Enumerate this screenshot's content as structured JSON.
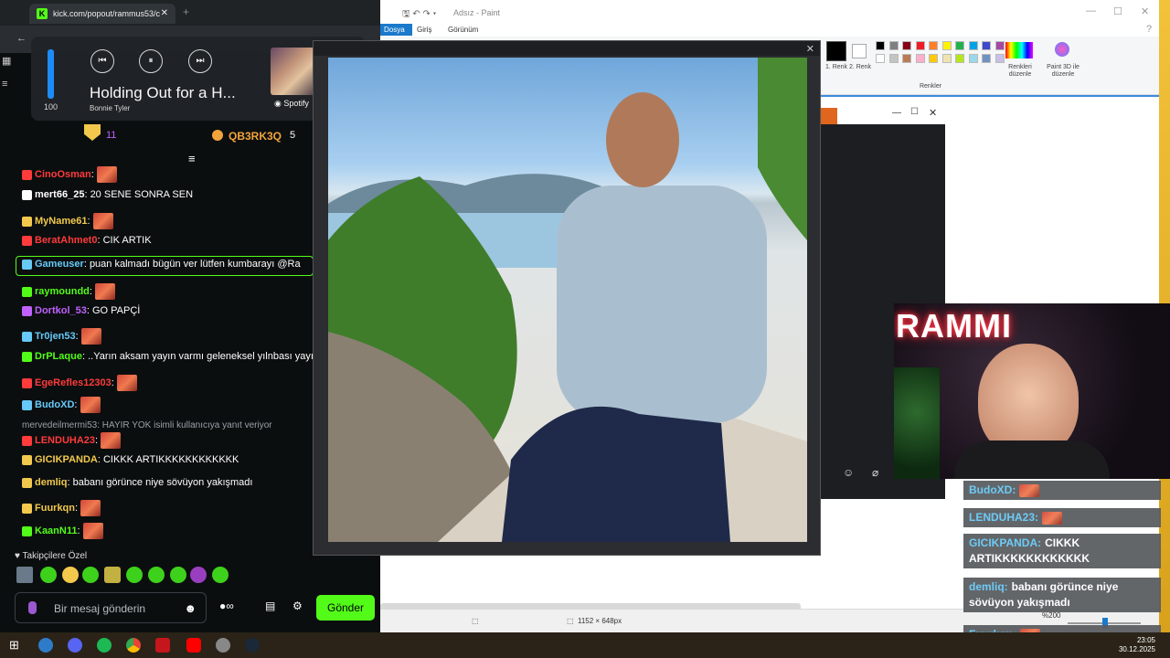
{
  "browser": {
    "tab_title": "kick.com/popout/rammus53/c",
    "tab_close": "✕",
    "new_tab": "+"
  },
  "media": {
    "volume": 100,
    "volume_label": "100",
    "song_title": "Holding Out for a H...",
    "artist": "Bonnie Tyler",
    "source": "Spotify",
    "prev_icon": "⏮",
    "pause_icon": "⏸",
    "next_icon": "⏭",
    "more_icon": "›"
  },
  "pinned": {
    "user1_count": "11",
    "user2": "QB3RK3Q",
    "user2_count": "5"
  },
  "chat": [
    {
      "user": "CinoOsman",
      "user_color": "#ff3b3b",
      "text": "",
      "emote": true
    },
    {
      "user": "mert66_25",
      "user_color": "#ffffff",
      "text": "20 SENE SONRA SEN",
      "emote": false
    },
    {
      "user": "MyName61",
      "user_color": "#f2c94c",
      "text": "",
      "emote": true
    },
    {
      "user": "BeratAhmet0",
      "user_color": "#ff3b3b",
      "text": "CIK ARTIK",
      "emote": false
    },
    {
      "user": "Gameuser",
      "user_color": "#66c9f7",
      "text": "puan kalmadı bügün ver lütfen kumbarayı @Ra",
      "emote": false
    },
    {
      "user": "raymoundd",
      "user_color": "#53fc18",
      "text": "",
      "emote": true
    },
    {
      "user": "Dortkol_53",
      "user_color": "#c061ff",
      "text": "GO PAPÇİ",
      "emote": false
    },
    {
      "user": "Tr0jen53",
      "user_color": "#66c9f7",
      "text": "",
      "emote": true
    },
    {
      "user": "DrPLaque",
      "user_color": "#53fc18",
      "text": "..Yarın aksam yayın varmı geleneksel yılnbası yayın",
      "emote": false
    },
    {
      "user": "EgeRefles12303",
      "user_color": "#ff3b3b",
      "text": "",
      "emote": true
    },
    {
      "user": "BudoXD",
      "user_color": "#66c9f7",
      "text": "",
      "emote": true
    },
    {
      "user": "LENDUHA23",
      "user_color": "#ff3b3b",
      "text": "",
      "emote": true
    },
    {
      "user": "GICIKPANDA",
      "user_color": "#f2c94c",
      "text": "CIKKK ARTIKKKKKKKKKKKK",
      "emote": false
    },
    {
      "user": "demliq",
      "user_color": "#f2c94c",
      "text": "babanı görünce niye sövüyon yakışmadı",
      "emote": false
    },
    {
      "user": "Fuurkqn",
      "user_color": "#f2c94c",
      "text": "",
      "emote": true
    },
    {
      "user": "KaanN11",
      "user_color": "#53fc18",
      "text": "",
      "emote": true
    }
  ],
  "reply_hint": "mervedeilmermi53: HAYIR YOK isimli kullanıcıya yanıt veriyor",
  "followers_only": "Takipçilere Özel",
  "input": {
    "placeholder": "Bir mesaj gönderin",
    "send_label": "Gönder"
  },
  "paint": {
    "title": "Adsız - Paint",
    "tabs": [
      "Dosya",
      "Giriş",
      "Görünüm"
    ],
    "color1_label": "1.\nRenk",
    "color2_label": "2.\nRenk",
    "edit_colors": "Renkleri düzenle",
    "paint3d": "Paint 3D ile düzenle",
    "group_label": "Renkler",
    "status_size": "1152 × 648px",
    "zoom": "%200",
    "palette": [
      "#000000",
      "#7f7f7f",
      "#880015",
      "#ed1c24",
      "#ff7f27",
      "#fff200",
      "#22b14c",
      "#00a2e8",
      "#3f48cc",
      "#a349a4",
      "#ffffff",
      "#c3c3c3",
      "#b97a57",
      "#ffaec9",
      "#ffc90e",
      "#efe4b0",
      "#b5e61d",
      "#99d9ea",
      "#7092be",
      "#c8bfe7"
    ]
  },
  "webcam": {
    "neon_text": "RAMMI"
  },
  "overlay_chat": [
    {
      "user": "BudoXD:",
      "text": ""
    },
    {
      "user": "LENDUHA23:",
      "text": ""
    },
    {
      "user": "GICIKPANDA:",
      "text": "CIKKK ARTIKKKKKKKKKKKK"
    },
    {
      "user": "demliq:",
      "text": "babanı görünce niye sövüyon yakışmadı"
    },
    {
      "user": "Fuurkqn:",
      "text": ""
    }
  ],
  "taskbar": {
    "time": "23:05",
    "date": "30.12.2025"
  }
}
